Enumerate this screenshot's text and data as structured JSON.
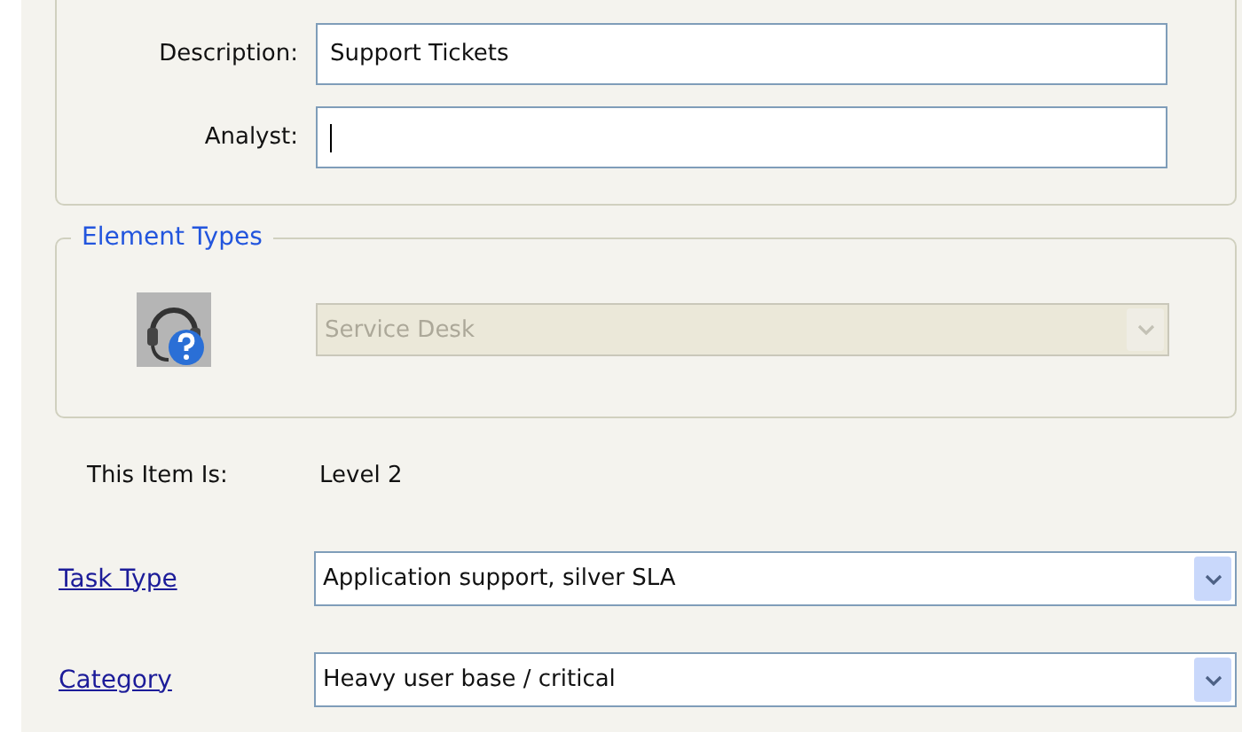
{
  "fields": [
    {
      "label": "Description:",
      "value": "Support Tickets",
      "focused": false
    },
    {
      "label": "Analyst:",
      "focused": true
    }
  ],
  "element_types": {
    "legend": "Element Types",
    "dropdown": {
      "value": "Service Desk",
      "disabled": true
    }
  },
  "item_level": {
    "label": "This Item Is:",
    "value": "Level 2"
  },
  "selects": [
    {
      "label": "Task Type",
      "value": "Application support, silver SLA",
      "disabled": false
    },
    {
      "label": "Category",
      "value": "Heavy user base / critical",
      "disabled": false
    }
  ]
}
